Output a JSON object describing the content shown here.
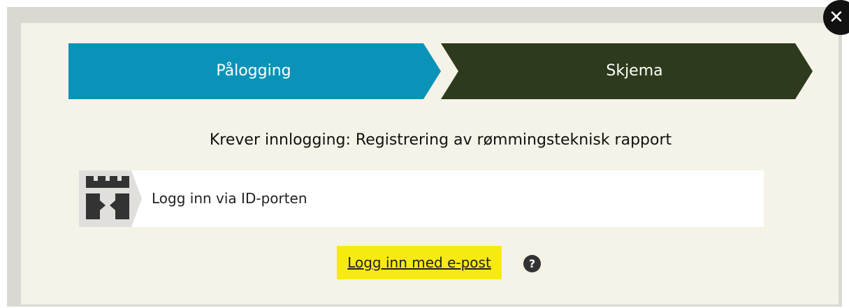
{
  "modal": {
    "close_icon": "close-icon",
    "close_glyph": "✕"
  },
  "steps": [
    {
      "label": "Pålogging",
      "active": true,
      "color": "#0a93b8"
    },
    {
      "label": "Skjema",
      "active": false,
      "color": "#2d3a1b"
    }
  ],
  "heading": "Krever innlogging: Registrering av rømmingsteknisk rapport",
  "idporten": {
    "icon": "id-porten-gate-icon",
    "label": "Logg inn via ID-porten"
  },
  "email_login": {
    "label": "Logg inn med e-post",
    "highlight_color": "#f7ea12"
  },
  "help": {
    "icon": "help-icon",
    "glyph": "?"
  },
  "colors": {
    "modal_background": "#f5f3e7",
    "frame_background": "#d9d9d2"
  }
}
